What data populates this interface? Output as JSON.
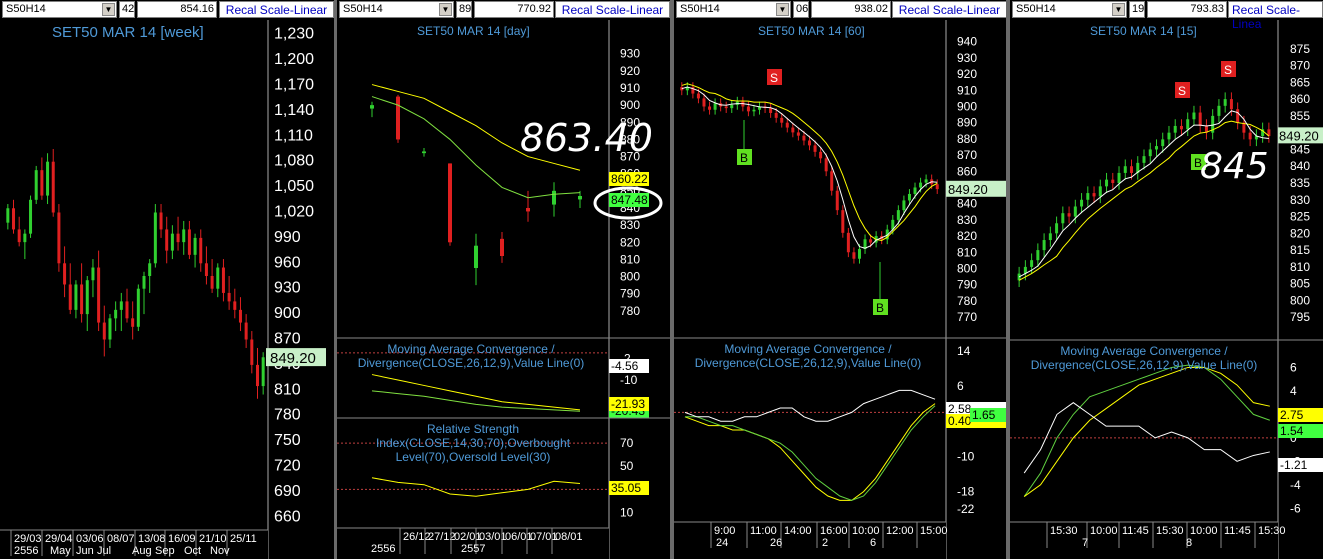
{
  "panels": [
    {
      "symbol": "S50H14",
      "field1": "42",
      "field2": "854.16",
      "recal_label": "Recal Scale-Linear",
      "title": "SET50 MAR 14  [week]",
      "last_price_label": "849.20"
    },
    {
      "symbol": "S50H14",
      "field1": "89",
      "field2": "770.92",
      "recal_label": "Recal Scale-Linear",
      "title": "SET50 MAR 14  [day]",
      "annotation": "863.40",
      "macd_title": "Moving Average Convergence / Divergence(CLOSE,26,12,9),Value Line(0)",
      "rsi_title": "Relative Strength Index(CLOSE,14,30,70),Overbought Level(70),Oversold Level(30)"
    },
    {
      "symbol": "S50H14",
      "field1": "06",
      "field2": "938.02",
      "recal_label": "Recal Scale-Linear",
      "title": "SET50 MAR 14  [60]",
      "last_price_label": "849.20",
      "macd_title": "Moving Average Convergence / Divergence(CLOSE,26,12,9),Value Line(0)"
    },
    {
      "symbol": "S50H14",
      "field1": "19",
      "field2": "793.83",
      "recal_label": "Recal Scale-Linea",
      "title": "SET50 MAR 14  [15]",
      "last_price_label": "849.20",
      "annotation": "845",
      "macd_title": "Moving Average Convergence / Divergence(CLOSE,26,12,9),Value Line(0)"
    }
  ],
  "chart_data": [
    {
      "type": "candlestick",
      "title": "SET50 MAR 14  [week]",
      "y_ticks": [
        "1,230",
        "1,200",
        "1,170",
        "1,140",
        "1,110",
        "1,080",
        "1,050",
        "1,020",
        "990",
        "960",
        "930",
        "900",
        "870",
        "840",
        "810",
        "780",
        "750",
        "720",
        "690",
        "660"
      ],
      "ylim": [
        645,
        1245
      ],
      "x_ticks": [
        "29/03",
        "29/04",
        "03/06",
        "08/07",
        "13/08",
        "16/09",
        "21/10",
        "25/11"
      ],
      "x_ticks_month": [
        "2556",
        "May",
        "Jun",
        "Jul",
        "Aug",
        "Sep",
        "Oct",
        "Nov"
      ],
      "last_value": 849.2,
      "candles": [
        [
          1008,
          1030,
          1000,
          1025
        ],
        [
          1025,
          1035,
          995,
          1000
        ],
        [
          1000,
          1015,
          980,
          985
        ],
        [
          985,
          1000,
          965,
          995
        ],
        [
          995,
          1040,
          990,
          1035
        ],
        [
          1035,
          1075,
          1030,
          1070
        ],
        [
          1070,
          1085,
          1035,
          1040
        ],
        [
          1040,
          1090,
          1030,
          1080
        ],
        [
          1080,
          1095,
          1015,
          1020
        ],
        [
          1020,
          1030,
          950,
          960
        ],
        [
          960,
          980,
          920,
          935
        ],
        [
          935,
          960,
          900,
          905
        ],
        [
          905,
          940,
          895,
          935
        ],
        [
          935,
          960,
          890,
          900
        ],
        [
          900,
          945,
          880,
          940
        ],
        [
          940,
          965,
          920,
          955
        ],
        [
          955,
          975,
          880,
          890
        ],
        [
          890,
          910,
          850,
          870
        ],
        [
          870,
          900,
          860,
          895
        ],
        [
          895,
          915,
          880,
          905
        ],
        [
          905,
          925,
          880,
          915
        ],
        [
          915,
          930,
          890,
          895
        ],
        [
          895,
          915,
          870,
          885
        ],
        [
          885,
          935,
          880,
          930
        ],
        [
          930,
          950,
          900,
          945
        ],
        [
          945,
          965,
          925,
          960
        ],
        [
          960,
          1030,
          955,
          1020
        ],
        [
          1020,
          1030,
          990,
          1000
        ],
        [
          1000,
          1015,
          960,
          975
        ],
        [
          975,
          1005,
          965,
          995
        ],
        [
          995,
          1015,
          975,
          985
        ],
        [
          985,
          1010,
          970,
          1000
        ],
        [
          1000,
          1010,
          965,
          970
        ],
        [
          970,
          995,
          955,
          990
        ],
        [
          990,
          1000,
          950,
          960
        ],
        [
          960,
          980,
          935,
          945
        ],
        [
          945,
          965,
          925,
          930
        ],
        [
          930,
          960,
          920,
          955
        ],
        [
          955,
          965,
          915,
          925
        ],
        [
          925,
          945,
          905,
          915
        ],
        [
          915,
          930,
          895,
          905
        ],
        [
          905,
          920,
          880,
          890
        ],
        [
          890,
          900,
          860,
          870
        ],
        [
          870,
          880,
          830,
          840
        ],
        [
          840,
          860,
          800,
          815
        ],
        [
          815,
          855,
          805,
          849
        ]
      ]
    },
    {
      "type": "candlestick",
      "title": "SET50 MAR 14  [day]",
      "y_ticks": [
        "930",
        "920",
        "910",
        "900",
        "890",
        "880",
        "870",
        "860",
        "850",
        "840",
        "830",
        "820",
        "810",
        "800",
        "790",
        "780"
      ],
      "ylim": [
        770,
        938
      ],
      "x_ticks": [
        "26/12",
        "27/12",
        "02/01",
        "03/01",
        "06/01",
        "07/01",
        "08/01"
      ],
      "x_ticks_year": [
        "2556",
        "2557"
      ],
      "value_labels": [
        "860.22",
        "847.48"
      ],
      "candles": [
        [
          898,
          902,
          893,
          900
        ],
        [
          905,
          906,
          878,
          880
        ],
        [
          872,
          875,
          870,
          873
        ],
        [
          866,
          866,
          818,
          820
        ],
        [
          805,
          825,
          795,
          818
        ],
        [
          822,
          826,
          808,
          812
        ],
        [
          840,
          850,
          832,
          838
        ],
        [
          842,
          855,
          835,
          850
        ],
        [
          845,
          850,
          840,
          847
        ]
      ],
      "ma_short": [
        905,
        900,
        892,
        880,
        865,
        852,
        846,
        848,
        849
      ],
      "ma_long": [
        912,
        908,
        904,
        896,
        888,
        878,
        870,
        866,
        862
      ],
      "macd": {
        "ylim": [
          -24,
          4
        ],
        "y_ticks": [
          "-2",
          "-10",
          "-18"
        ],
        "labels": [
          "-4.56",
          "-21.93",
          "-20.43"
        ],
        "macd": [
          -8,
          -10,
          -12,
          -14,
          -16,
          -18,
          -19,
          -20,
          -21
        ],
        "signal": [
          -14,
          -15,
          -16,
          -17.5,
          -19,
          -20,
          -20.5,
          -21,
          -21.5
        ]
      },
      "rsi": {
        "ylim": [
          0,
          90
        ],
        "y_ticks": [
          "70",
          "50",
          "30",
          "10"
        ],
        "labels": [
          "35.05"
        ],
        "values": [
          40,
          36,
          34,
          26,
          24,
          27,
          30,
          37,
          35
        ]
      }
    },
    {
      "type": "candlestick",
      "title": "SET50 MAR 14  [60]",
      "y_ticks": [
        "940",
        "930",
        "920",
        "910",
        "900",
        "890",
        "880",
        "870",
        "860",
        "850",
        "840",
        "830",
        "820",
        "810",
        "800",
        "790",
        "780",
        "770"
      ],
      "ylim": [
        762,
        946
      ],
      "x_ticks": [
        "9:00",
        "11:00",
        "14:00",
        "16:00",
        "10:00",
        "12:00",
        "15:00"
      ],
      "x_ticks_day": [
        "24",
        "26",
        "2",
        "6"
      ],
      "last_value": 849.2,
      "markers": [
        {
          "type": "S",
          "label": "S"
        },
        {
          "type": "B",
          "label": "B"
        },
        {
          "type": "B",
          "label": "B"
        }
      ],
      "macd": {
        "ylim": [
          -24,
          16
        ],
        "y_ticks": [
          "14",
          "6",
          "-2",
          "-10",
          "-18",
          "-22"
        ],
        "labels": [
          "2.58",
          "1.65",
          "0.40"
        ]
      }
    },
    {
      "type": "candlestick",
      "title": "SET50 MAR 14  [15]",
      "y_ticks": [
        "875",
        "870",
        "865",
        "860",
        "855",
        "850",
        "845",
        "840",
        "835",
        "830",
        "825",
        "820",
        "815",
        "810",
        "805",
        "800",
        "795"
      ],
      "ylim": [
        790,
        880
      ],
      "x_ticks": [
        "15:30",
        "10:00",
        "11:45",
        "15:30",
        "10:00",
        "11:45",
        "15:30"
      ],
      "x_ticks_day": [
        "7",
        "8"
      ],
      "last_value": 849.2,
      "markers": [
        {
          "type": "S",
          "label": "S"
        },
        {
          "type": "S",
          "label": "S"
        },
        {
          "type": "B",
          "label": "B"
        }
      ],
      "macd": {
        "ylim": [
          -7,
          8
        ],
        "y_ticks": [
          "6",
          "4",
          "2",
          "0",
          "-2",
          "-4",
          "-6"
        ],
        "labels": [
          "2.75",
          "1.54",
          "-1.21"
        ]
      }
    }
  ],
  "colors": {
    "up": "#30d030",
    "down": "#e02020",
    "axis_text": "#ffffff",
    "title": "#4f9ad8",
    "yellow": "#ffff00",
    "green_label": "#40ff40",
    "price_label_bg": "#c8f0c8"
  }
}
